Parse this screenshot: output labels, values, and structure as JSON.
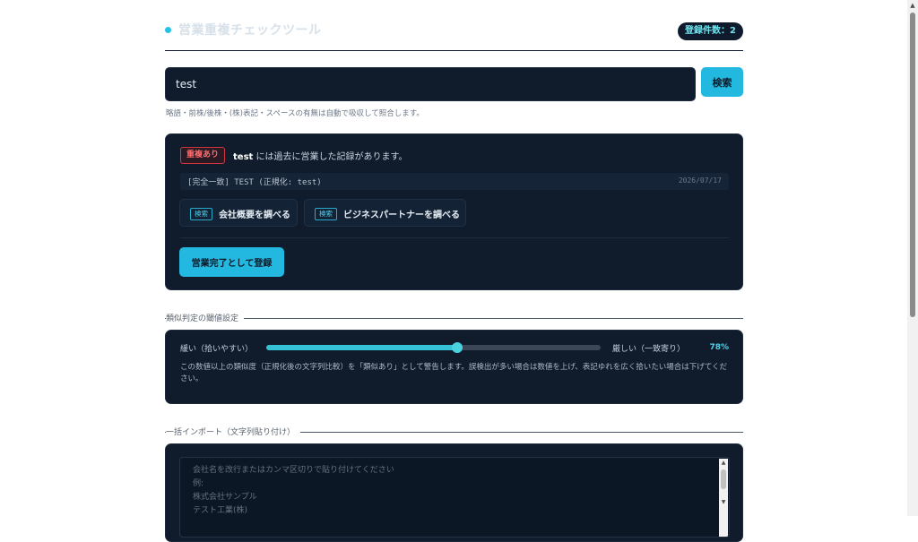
{
  "header": {
    "title": "営業重複チェックツール",
    "count_label": "登録件数：2"
  },
  "search": {
    "value": "test",
    "button_label": "検索",
    "hint": "略語・前株/後株・(株)表記・スペースの有無は自動で吸収して照合します。"
  },
  "result": {
    "badge": "重複あり",
    "query": "test",
    "message_suffix": " には過去に営業した記録があります。",
    "match_text": "[完全一致] TEST (正規化: test)",
    "match_date": "2026/07/17",
    "chips": [
      {
        "tag": "検索",
        "label": "会社概要を調べる"
      },
      {
        "tag": "検索",
        "label": "ビジネスパートナーを調べる"
      }
    ],
    "register_label": "営業完了として登録"
  },
  "threshold": {
    "section_title": "類似判定の閾値設定",
    "loose_label": "緩い（拾いやすい）",
    "strict_label": "厳しい（一致寄り）",
    "value_label": "78%",
    "slider_fraction": 0.57,
    "description": "この数値以上の類似度（正規化後の文字列比較）を「類似あり」として警告します。誤検出が多い場合は数値を上げ、表記ゆれを広く拾いたい場合は下げてください。"
  },
  "import": {
    "section_title": "一括インポート（文字列貼り付け）",
    "placeholder_lines": [
      "会社名を改行またはカンマ区切りで貼り付けてください",
      "例:",
      "株式会社サンプル",
      "テスト工業(株)"
    ]
  },
  "colors": {
    "accent": "#22b8df",
    "card_bg": "#101c2c",
    "danger": "#d0363e"
  }
}
